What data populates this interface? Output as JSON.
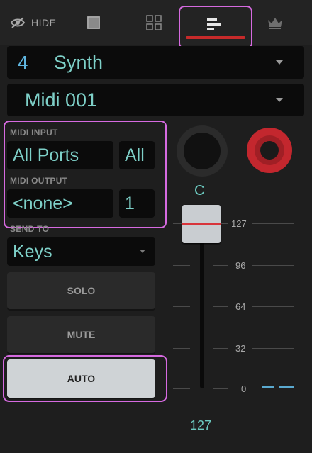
{
  "toolbar": {
    "hide_label": "HIDE",
    "tabs": [
      {
        "icon": "square-icon"
      },
      {
        "icon": "grid-icon"
      },
      {
        "icon": "mixer-bars-icon",
        "active": true
      },
      {
        "icon": "crown-icon"
      }
    ]
  },
  "track": {
    "number": "4",
    "name": "Synth"
  },
  "midi_track": {
    "name": "Midi 001"
  },
  "midi_input": {
    "label": "MIDI INPUT",
    "port": "All",
    "channel": "All"
  },
  "midi_input_port_text": "All Ports",
  "midi_output": {
    "label": "MIDI OUTPUT",
    "port": "<none>",
    "channel": "1"
  },
  "send_to": {
    "label": "SEND TO",
    "value": "Keys"
  },
  "buttons": {
    "solo": "SOLO",
    "mute": "MUTE",
    "auto": "AUTO"
  },
  "pan": {
    "value": "C"
  },
  "fader": {
    "scale": [
      "127",
      "96",
      "64",
      "32",
      "0"
    ],
    "value": "127",
    "level": 1.0
  },
  "colors": {
    "accent": "#7ed0c8",
    "highlight": "#d66ae0",
    "record": "#c3272e",
    "track_number": "#5fb6e0"
  }
}
